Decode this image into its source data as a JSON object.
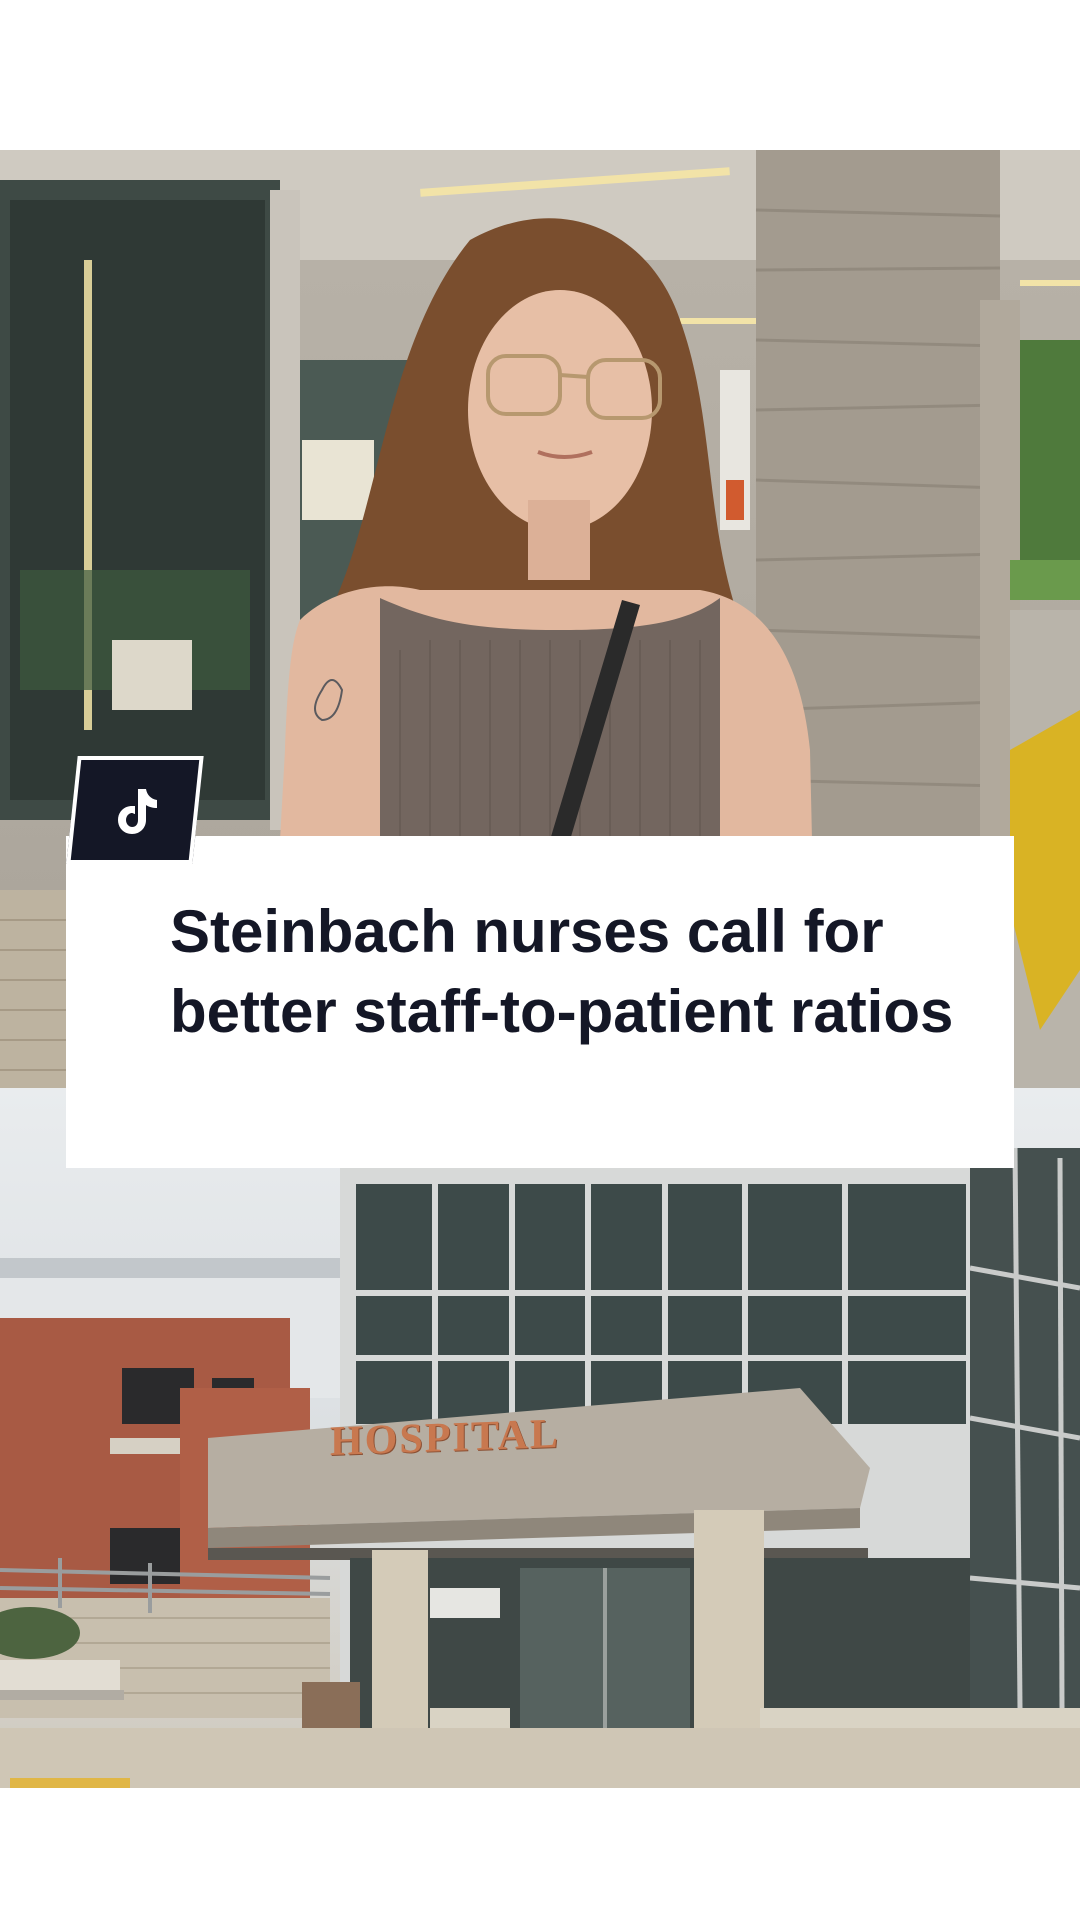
{
  "post": {
    "headline": "Steinbach nurses call for better staff-to-patient ratios",
    "badge_icon": "tiktok-logo-icon",
    "hospital_sign": "HOSPITAL",
    "colors": {
      "headline_text": "#141726",
      "badge_background": "#141726",
      "card_background": "#ffffff",
      "sign": "#c8784f"
    }
  },
  "images": {
    "top": "woman-outside-hospital-photo",
    "bottom": "hospital-entrance-photo"
  }
}
